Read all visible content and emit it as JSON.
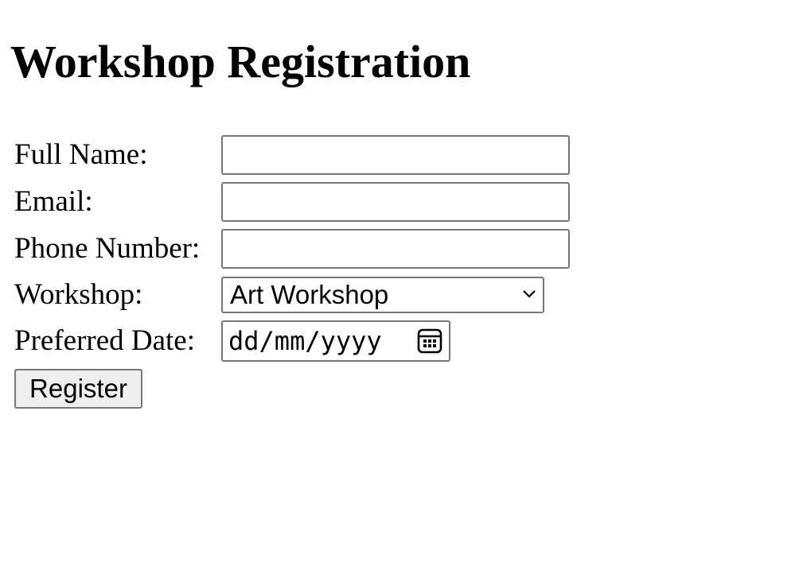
{
  "page": {
    "title": "Workshop Registration"
  },
  "form": {
    "full_name": {
      "label": "Full Name:",
      "value": "",
      "placeholder": ""
    },
    "email": {
      "label": "Email:",
      "value": "",
      "placeholder": ""
    },
    "phone": {
      "label": "Phone Number:",
      "value": "",
      "placeholder": ""
    },
    "workshop": {
      "label": "Workshop:",
      "selected": "Art Workshop"
    },
    "preferred_date": {
      "label": "Preferred Date:",
      "placeholder": "dd/mm/yyyy",
      "icon": "calendar-icon"
    },
    "submit_label": "Register"
  },
  "colors": {
    "border": "#767676",
    "button_background": "#efefef",
    "text": "#000000",
    "background": "#ffffff"
  }
}
